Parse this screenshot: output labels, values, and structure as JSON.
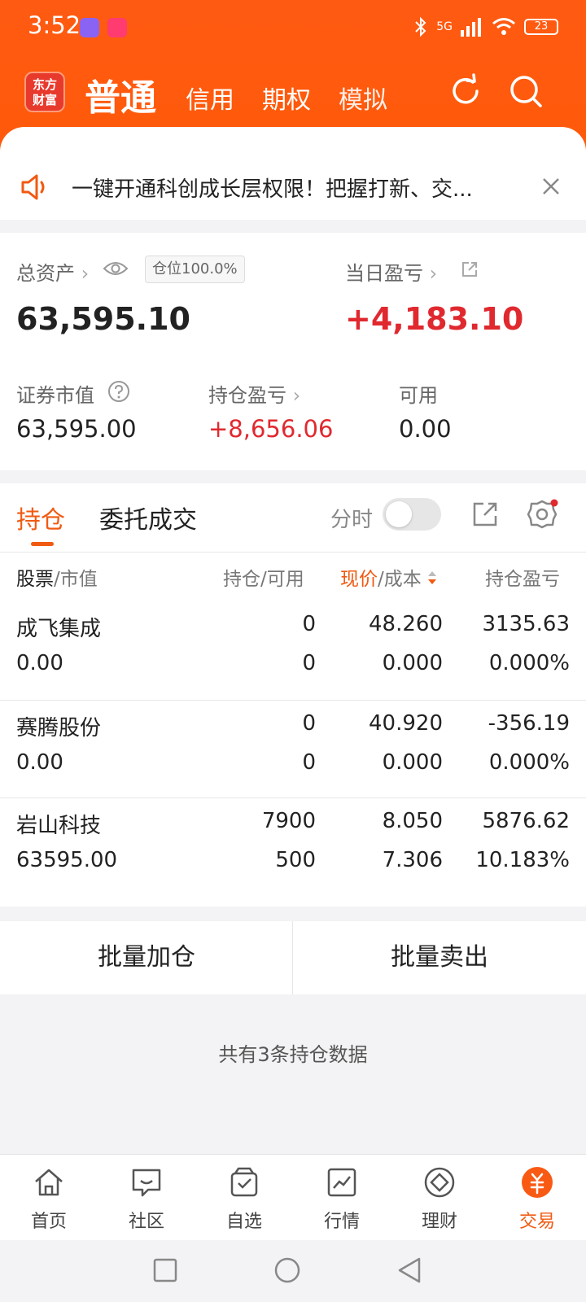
{
  "status_bar": {
    "time": "3:52",
    "battery": "23",
    "network": "5G"
  },
  "header": {
    "logo_line1": "东方",
    "logo_line2": "财富",
    "tabs": [
      {
        "label": "普通",
        "active": true
      },
      {
        "label": "信用",
        "active": false
      },
      {
        "label": "期权",
        "active": false
      },
      {
        "label": "模拟",
        "active": false
      }
    ],
    "accent": "#ff5a12"
  },
  "notice": {
    "text": "一键开通科创成长层权限！把握打新、交..."
  },
  "assets": {
    "total_label": "总资产",
    "position_badge": "仓位100.0%",
    "total_value": "63,595.10",
    "daily_pl_label": "当日盈亏",
    "daily_pl_value": "+4,183.10",
    "market_value_label": "证券市值",
    "market_value": "63,595.00",
    "holding_pl_label": "持仓盈亏",
    "holding_pl": "+8,656.06",
    "available_label": "可用",
    "available": "0.00"
  },
  "holdings": {
    "tab_positions": "持仓",
    "tab_orders": "委托成交",
    "intraday_label": "分时",
    "headers": {
      "stock_a": "股票",
      "stock_b": "/市值",
      "qty": "持仓/可用",
      "price_a": "现价",
      "price_b": "/成本",
      "pl": "持仓盈亏"
    },
    "rows": [
      {
        "name": "成飞集成",
        "value": "0.00",
        "qty": "0",
        "avail": "0",
        "price": "48.260",
        "cost": "0.000",
        "pl": "3135.63",
        "pl_pct": "0.000%",
        "color": "red"
      },
      {
        "name": "赛腾股份",
        "value": "0.00",
        "qty": "0",
        "avail": "0",
        "price": "40.920",
        "cost": "0.000",
        "pl": "-356.19",
        "pl_pct": "0.000%",
        "color": "green"
      },
      {
        "name": "岩山科技",
        "value": "63595.00",
        "qty": "7900",
        "avail": "500",
        "price": "8.050",
        "cost": "7.306",
        "pl": "5876.62",
        "pl_pct": "10.183%",
        "color": "red"
      }
    ],
    "bulk_add": "批量加仓",
    "bulk_sell": "批量卖出",
    "count_text": "共有3条持仓数据"
  },
  "bottom_nav": [
    {
      "label": "首页",
      "icon": "home-icon",
      "active": false
    },
    {
      "label": "社区",
      "icon": "community-icon",
      "active": false
    },
    {
      "label": "自选",
      "icon": "watchlist-icon",
      "active": false
    },
    {
      "label": "行情",
      "icon": "market-icon",
      "active": false
    },
    {
      "label": "理财",
      "icon": "wealth-icon",
      "active": false
    },
    {
      "label": "交易",
      "icon": "trade-icon",
      "active": true
    }
  ]
}
